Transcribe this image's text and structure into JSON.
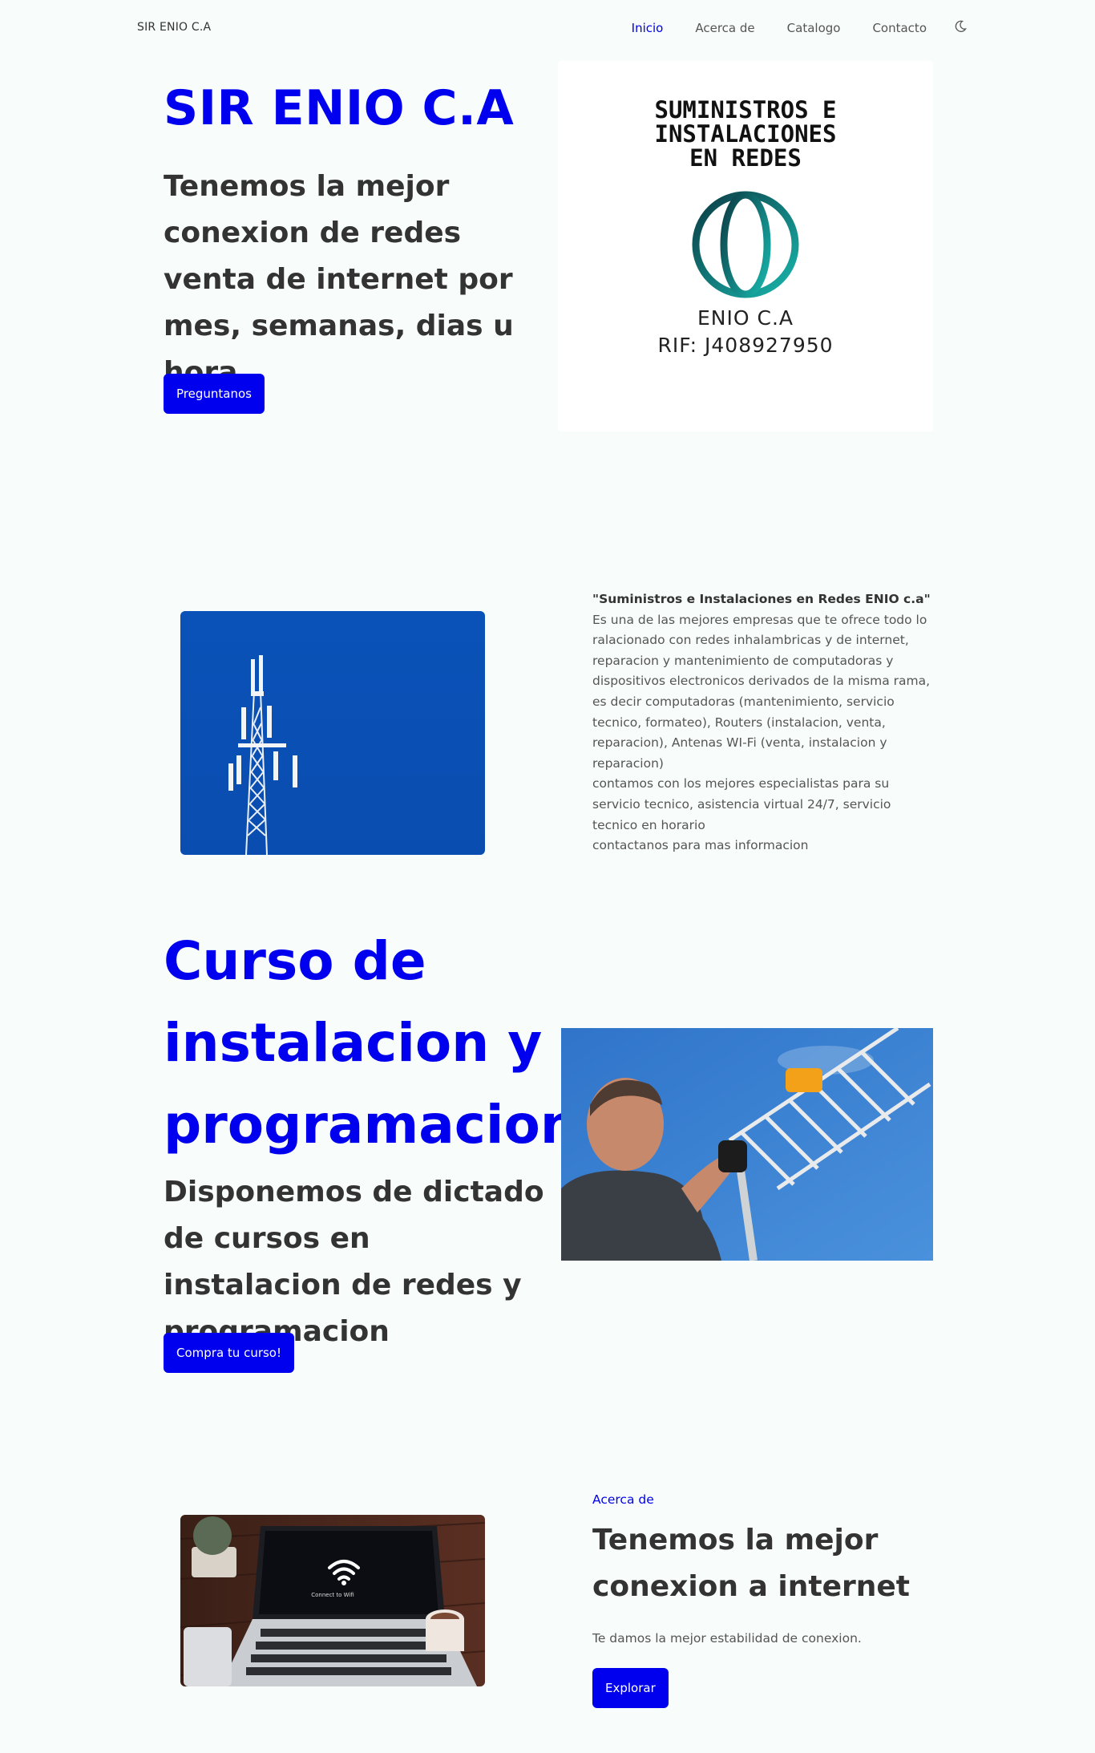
{
  "nav": {
    "brand": "SIR ENIO C.A",
    "links": [
      "Inicio",
      "Acerca de",
      "Catalogo",
      "Contacto"
    ],
    "theme_toggle_icon": "moon-icon"
  },
  "hero": {
    "title": "SIR ENIO C.A",
    "subtitle": "Tenemos la mejor conexion de redes venta de internet por mes, semanas, dias u hora",
    "button": "Preguntanos"
  },
  "logo": {
    "heading_lines": [
      "SUMINISTROS E",
      "INSTALACIONES",
      "EN REDES"
    ],
    "icon": "globe-icon",
    "name": "ENIO C.A",
    "rif": "RIF: J408927950"
  },
  "about": {
    "image": "telecom-tower-photo",
    "strong": "\"Suministros e Instalaciones en Redes ENIO c.a\"",
    "lead": " Es una de las mejores empresas que te ofrece todo lo ralacionado con redes inhalambricas y de internet, reparacion y mantenimiento de computadoras y dispositivos electronicos derivados de la misma rama, es decir computadoras (mantenimiento, servicio tecnico, formateo), Routers (instalacion, venta, reparacion), Antenas WI-Fi (venta, instalacion y reparacion)",
    "line2": "contamos con los mejores especialistas para su servicio tecnico, asistencia virtual 24/7, servicio tecnico en horario",
    "line3": "contactanos para mas informacion"
  },
  "course": {
    "title": "Curso de instalacion y programacion",
    "subtitle": "Disponemos de dictado de cursos en instalacion de redes y programacion",
    "button": "Compra tu curso!",
    "image": "technician-antenna-photo"
  },
  "bottom": {
    "image": "laptop-wifi-photo",
    "laptop_screen_text": "Connect to Wifi",
    "eyebrow": "Acerca de",
    "title": "Tenemos la mejor conexion a internet",
    "text": "Te damos la mejor estabilidad de conexion.",
    "button": "Explorar"
  },
  "colors": {
    "accent": "#0000ee",
    "background": "#f8fcfb",
    "heading": "#333333",
    "body_text": "#555555"
  }
}
